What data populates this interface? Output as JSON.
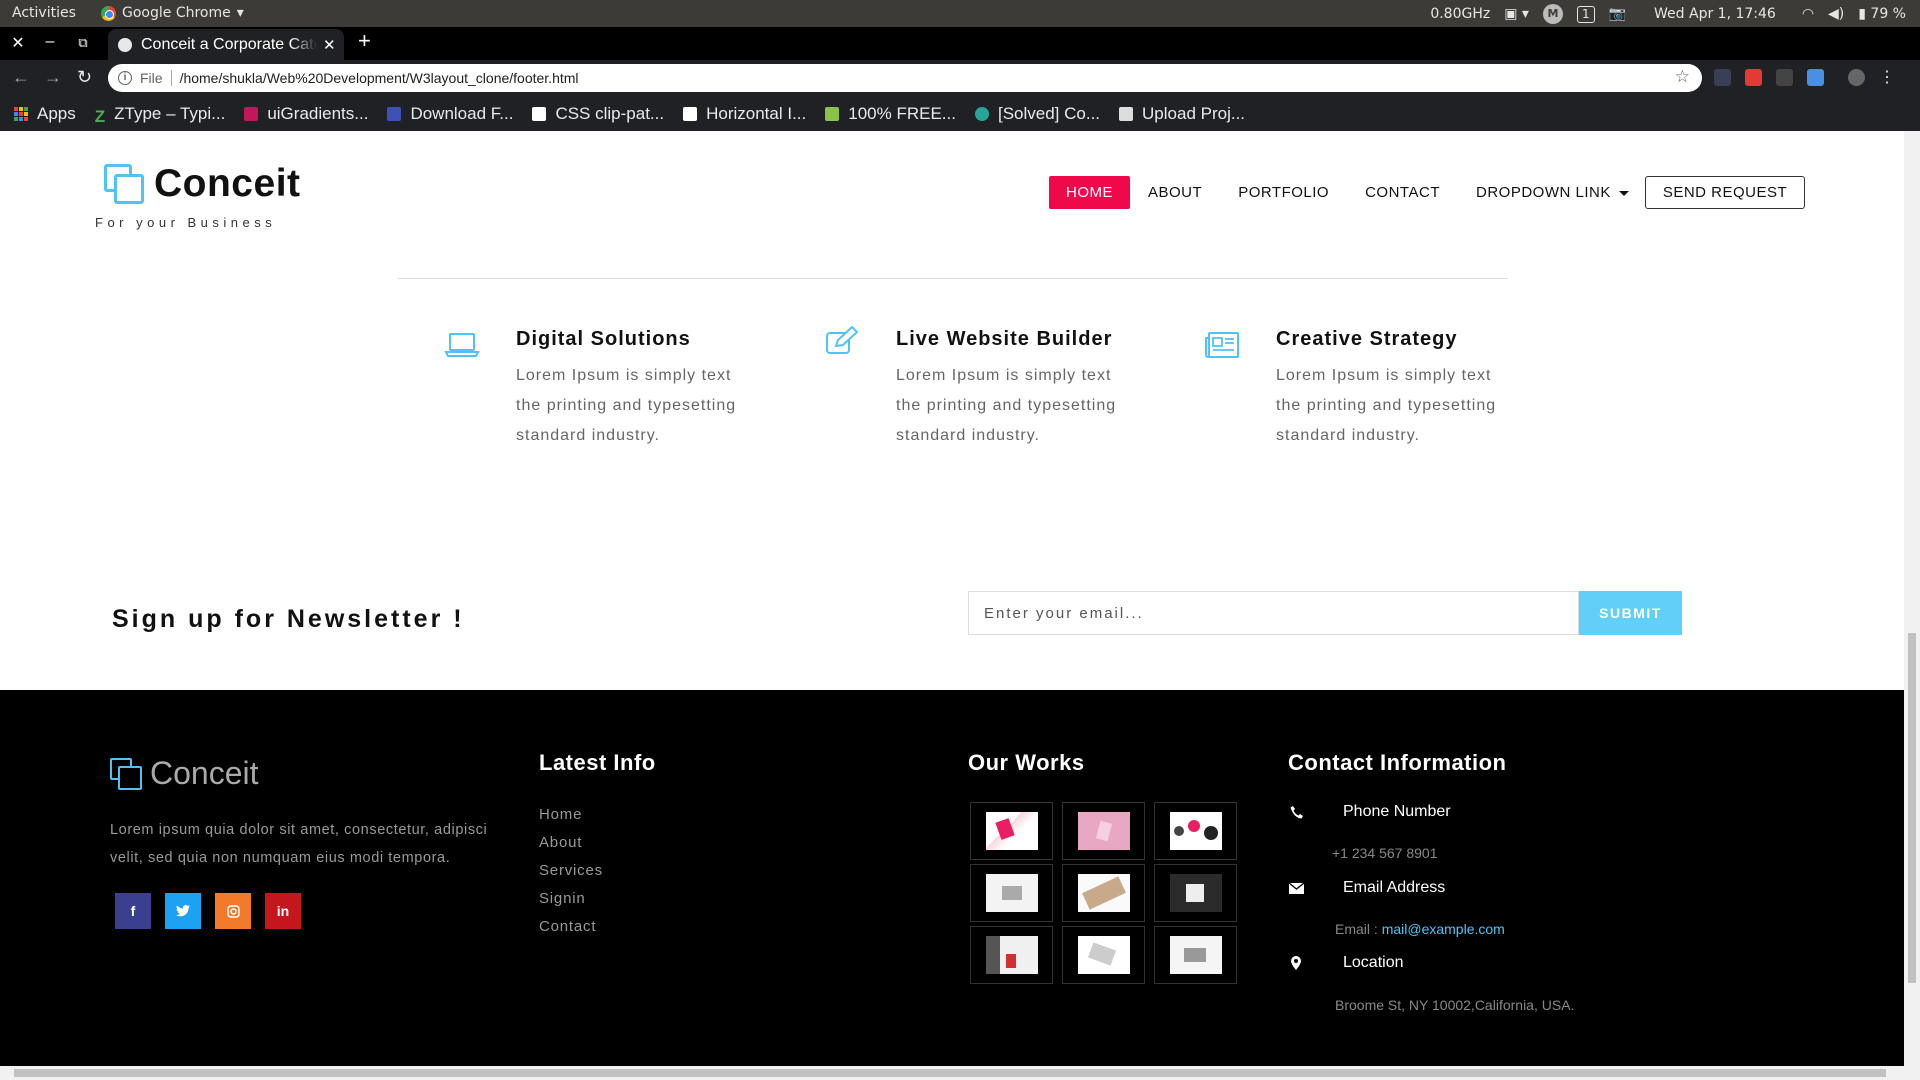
{
  "os": {
    "activities": "Activities",
    "app_name": "Google Chrome",
    "cpu": "0.80GHz",
    "workspace": "1",
    "datetime": "Wed Apr  1, 17:46",
    "battery": "79 %"
  },
  "browser": {
    "tab_title": "Conceit a Corporate Category",
    "address_label": "File",
    "url": "/home/shukla/Web%20Development/W3layout_clone/footer.html",
    "bookmarks": [
      "Apps",
      "ZType – Typi...",
      "uiGradients...",
      "Download F...",
      "CSS clip-pat...",
      "Horizontal I...",
      "100% FREE...",
      "[Solved] Co...",
      "Upload Proj..."
    ]
  },
  "header": {
    "logo": "Conceit",
    "tagline": "For your Business",
    "nav": {
      "home": "HOME",
      "about": "ABOUT",
      "portfolio": "PORTFOLIO",
      "contact": "CONTACT",
      "dropdown": "DROPDOWN LINK",
      "request": "SEND REQUEST"
    }
  },
  "features": [
    {
      "title": "Digital Solutions",
      "text": "Lorem Ipsum is simply text the printing and typesetting standard industry.",
      "icon": "laptop-icon"
    },
    {
      "title": "Live Website Builder",
      "text": "Lorem Ipsum is simply text the printing and typesetting standard industry.",
      "icon": "edit-icon"
    },
    {
      "title": "Creative Strategy",
      "text": "Lorem Ipsum is simply text the printing and typesetting standard industry.",
      "icon": "newspaper-icon"
    }
  ],
  "newsletter": {
    "title": "Sign up for Newsletter !",
    "placeholder": "Enter your email...",
    "submit": "SUBMIT"
  },
  "footer": {
    "logo": "Conceit",
    "about": "Lorem ipsum quia dolor sit amet, consectetur, adipisci velit, sed quia non numquam eius modi tempora.",
    "latest_info": {
      "bold": "Latest",
      "rest": " Info",
      "links": [
        "Home",
        "About",
        "Services",
        "Signin",
        "Contact"
      ]
    },
    "our_works": {
      "bold": "Our",
      "rest": " Works"
    },
    "contact_info": {
      "bold": "Contact",
      "rest": " Information",
      "phone_label": "Phone Number",
      "phone": "+1 234 567 8901",
      "email_label": "Email Address",
      "email_prefix": "Email :",
      "email": "mail@example.com",
      "location_label": "Location",
      "location": "Broome St, NY 10002,California, USA."
    }
  },
  "colors": {
    "accent_pink": "#f0094a",
    "accent_blue": "#4fc3f7",
    "submit_blue": "#60d0f8"
  }
}
